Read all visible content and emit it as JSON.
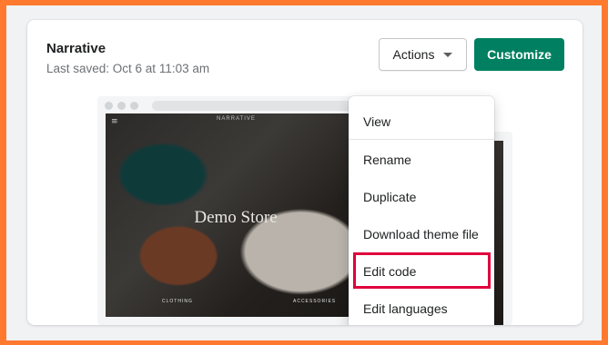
{
  "theme": {
    "name": "Narrative",
    "last_saved": "Last saved: Oct 6 at 11:03 am"
  },
  "buttons": {
    "actions_label": "Actions",
    "customize_label": "Customize"
  },
  "preview": {
    "store_title": "Demo Store",
    "logo_text": "NARRATIVE",
    "label_left": "CLOTHING",
    "label_right": "ACCESSORIES"
  },
  "menu": {
    "items": [
      {
        "label": "View"
      },
      {
        "label": "Rename"
      },
      {
        "label": "Duplicate"
      },
      {
        "label": "Download theme file"
      },
      {
        "label": "Edit code"
      },
      {
        "label": "Edit languages"
      }
    ],
    "highlighted_item": "Edit code"
  },
  "colors": {
    "frame": "#ff7a2f",
    "primary": "#008060",
    "highlight": "#e0003c"
  },
  "icons": {
    "menu": "hamburger-icon",
    "caret": "caret-down-icon",
    "cart": "cart-icon"
  }
}
